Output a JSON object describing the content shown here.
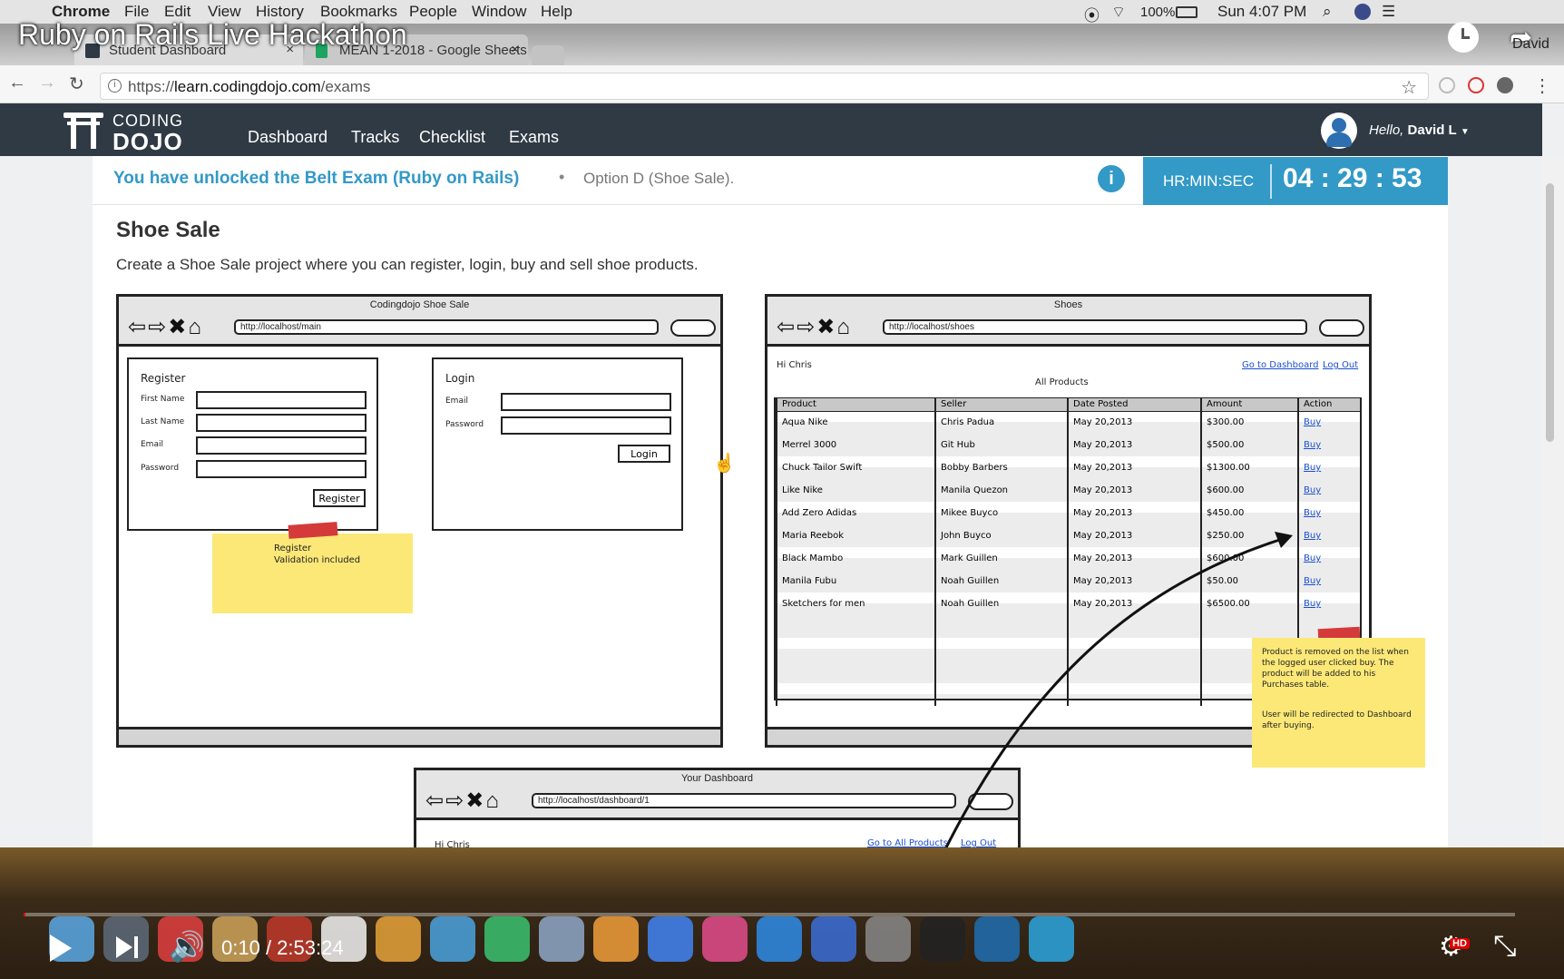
{
  "menubar": {
    "app": "Chrome",
    "items": [
      "File",
      "Edit",
      "View",
      "History",
      "Bookmarks",
      "People",
      "Window",
      "Help"
    ],
    "battery": "100%",
    "clock": "Sun 4:07 PM"
  },
  "video": {
    "title": "Ruby on Rails Live Hackathon",
    "user_label": "David",
    "time_current": "0:10",
    "time_total": "2:53:24",
    "progress": 0.001,
    "hd_badge": "HD"
  },
  "browser": {
    "tabs": [
      {
        "label": "Student Dashboard"
      },
      {
        "label": "MEAN 1-2018 - Google Sheets"
      }
    ],
    "url_scheme": "https://",
    "url_host": "learn.codingdojo.com",
    "url_path": "/exams"
  },
  "site": {
    "logo_top": "CODING",
    "logo_bottom": "DOJO",
    "nav": [
      "Dashboard",
      "Tracks",
      "Checklist",
      "Exams"
    ],
    "greeting": "Hello,",
    "user_name": "David L"
  },
  "banner": {
    "unlocked": "You have unlocked the Belt Exam (Ruby on Rails)",
    "option": "Option D (Shoe Sale).",
    "timer_label": "HR:MIN:SEC",
    "timer_value": "04 : 29 : 53"
  },
  "exam": {
    "title": "Shoe Sale",
    "description": "Create a Shoe Sale project where you can register, login, buy and sell shoe products."
  },
  "wireframe_main": {
    "window_title": "Codingdojo Shoe Sale",
    "url": "http://localhost/main",
    "register": {
      "heading": "Register",
      "fields": [
        "First Name",
        "Last Name",
        "Email",
        "Password"
      ],
      "button": "Register"
    },
    "login": {
      "heading": "Login",
      "fields": [
        "Email",
        "Password"
      ],
      "button": "Login"
    },
    "sticky": "Register\nValidation included"
  },
  "wireframe_shoes": {
    "window_title": "Shoes",
    "url": "http://localhost/shoes",
    "greeting": "Hi Chris",
    "link_dashboard": "Go to Dashboard",
    "link_logout": "Log Out",
    "table_title": "All Products",
    "columns": [
      "Product",
      "Seller",
      "Date Posted",
      "Amount",
      "Action"
    ],
    "rows": [
      [
        "Aqua Nike",
        "Chris Padua",
        "May 20,2013",
        "$300.00",
        "Buy"
      ],
      [
        "Merrel 3000",
        "Git Hub",
        "May 20,2013",
        "$500.00",
        "Buy"
      ],
      [
        "Chuck Tailor Swift",
        "Bobby Barbers",
        "May 20,2013",
        "$1300.00",
        "Buy"
      ],
      [
        "Like Nike",
        "Manila Quezon",
        "May 20,2013",
        "$600.00",
        "Buy"
      ],
      [
        "Add Zero Adidas",
        "Mikee Buyco",
        "May 20,2013",
        "$450.00",
        "Buy"
      ],
      [
        "Maria Reebok",
        "John Buyco",
        "May 20,2013",
        "$250.00",
        "Buy"
      ],
      [
        "Black Mambo",
        "Mark Guillen",
        "May 20,2013",
        "$600.00",
        "Buy"
      ],
      [
        "Manila Fubu",
        "Noah Guillen",
        "May 20,2013",
        "$50.00",
        "Buy"
      ],
      [
        "Sketchers for men",
        "Noah Guillen",
        "May 20,2013",
        "$6500.00",
        "Buy"
      ]
    ],
    "sticky_note_1": "Product is removed on the list when the logged user clicked buy.  The product will be added to his Purchases table.",
    "sticky_note_2": "User will be redirected to Dashboard after buying."
  },
  "wireframe_dashboard": {
    "window_title": "Your Dashboard",
    "url": "http://localhost/dashboard/1",
    "greeting": "Hi Chris",
    "link_products": "Go to All Products",
    "link_logout": "Log Out"
  },
  "colors": {
    "navbar": "#2f3a44",
    "accent": "#3399c7",
    "sticky": "#fbe877",
    "tape": "#d43a3a"
  }
}
